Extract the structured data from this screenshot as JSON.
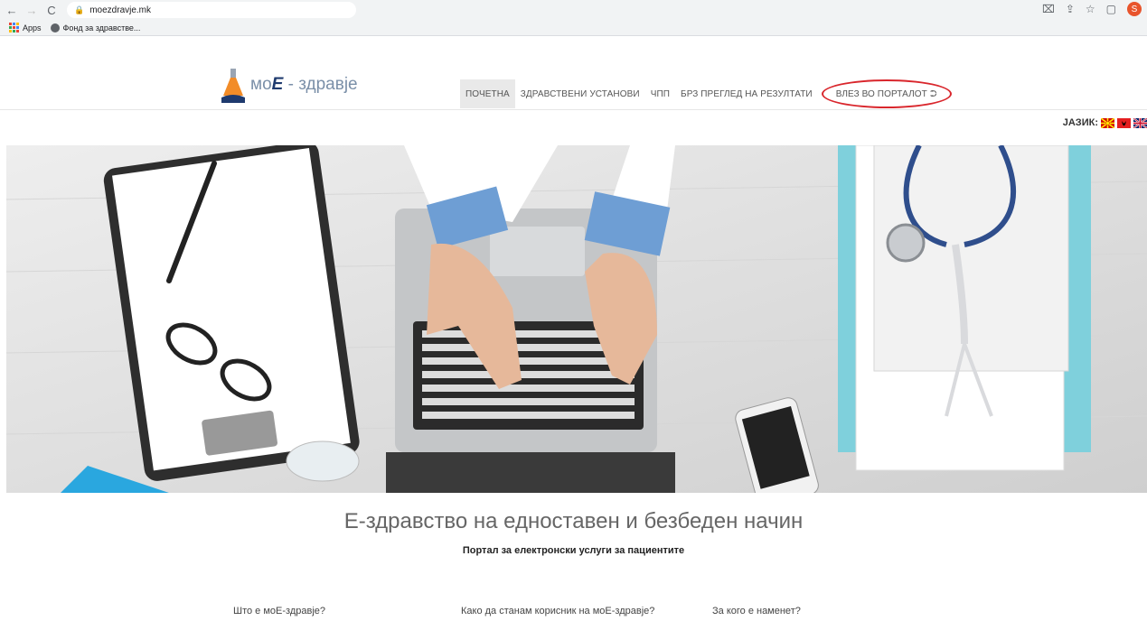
{
  "browser": {
    "url": "moezdravje.mk",
    "bookmarks": [
      {
        "label": "Apps"
      },
      {
        "label": "Фонд за здравстве..."
      }
    ],
    "profile_initial": "S"
  },
  "header": {
    "logo_prefix": "мо",
    "logo_emph": "E",
    "logo_suffix": " - здравје",
    "nav": [
      {
        "label": "ПОЧЕТНА",
        "active": true
      },
      {
        "label": "ЗДРАВСТВЕНИ УСТАНОВИ",
        "active": false
      },
      {
        "label": "ЧПП",
        "active": false
      },
      {
        "label": "БРЗ ПРЕГЛЕД НА РЕЗУЛТАТИ",
        "active": false
      }
    ],
    "portal_label": "ВЛЕЗ ВО ПОРТАЛОТ",
    "language_label": "ЈАЗИК:"
  },
  "main": {
    "tagline": "Е-здравство на едноставен и безбеден начин",
    "subtagline": "Портал за електронски услуги за пациентите",
    "links": [
      {
        "label": "Што е моE-здравје?"
      },
      {
        "label": "Како да станам корисник на моE-здравје?"
      },
      {
        "label": "За кого е наменет?"
      }
    ]
  }
}
